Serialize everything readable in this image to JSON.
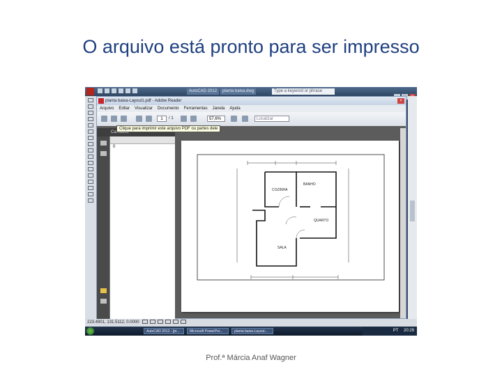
{
  "slide": {
    "title": "O arquivo está pronto para ser impresso",
    "footer": "Prof.ª Márcia Anaf Wagner"
  },
  "autocad": {
    "search_placeholder": "Type a keyword or phrase",
    "tabs": [
      "AutoCAD 2012",
      "planta baixa.dwg"
    ],
    "coordinates": "223.4901, 131.5112, 0.0000"
  },
  "acrobat": {
    "title": "planta baixa-Layout1.pdf - Adobe Reader",
    "menu": [
      "Arquivo",
      "Editar",
      "Visualizar",
      "Documento",
      "Ferramentas",
      "Janela",
      "Ajuda"
    ],
    "page_current": "1",
    "page_total": "/ 1",
    "zoom": "57,6%",
    "find_placeholder": "Localizar",
    "tooltip": "Clique para imprimir este arquivo PDF ou partes dele",
    "layers_header": "Camadas",
    "layer_item": "0"
  },
  "floor_plan": {
    "rooms": [
      "COZINHA",
      "BANHO",
      "QUARTO",
      "SALA"
    ]
  },
  "taskbar": {
    "items": [
      "AutoCAD 2012 - [pl...",
      "Microsoft PowerPoi...",
      "planta baixa-Layout..."
    ],
    "tray_lang": "PT",
    "time": "20:29"
  },
  "colors": {
    "title": "#1f3f7f",
    "acad_title_bar": "#3b4e6a",
    "acrobat_bg": "#5c5c5c",
    "tooltip_bg": "#ffffe1"
  }
}
